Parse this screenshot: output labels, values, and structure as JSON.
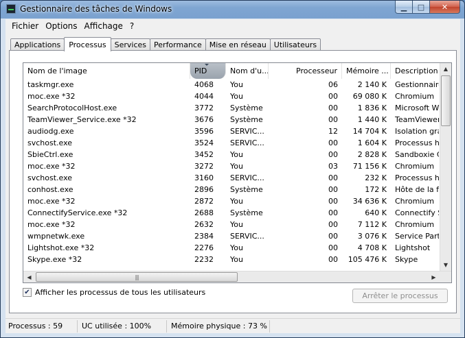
{
  "window": {
    "title": "Gestionnaire des tâches de Windows",
    "buttons": {
      "minimize": "▁",
      "maximize": "□",
      "close": "✕"
    }
  },
  "menu": [
    "Fichier",
    "Options",
    "Affichage",
    "?"
  ],
  "tabs": [
    "Applications",
    "Processus",
    "Services",
    "Performance",
    "Mise en réseau",
    "Utilisateurs"
  ],
  "active_tab": "Processus",
  "table": {
    "columns": [
      "Nom de l'image",
      "PID",
      "Nom d'u...",
      "Processeur",
      "Mémoire ...",
      "Description"
    ],
    "sorted_column": "PID",
    "rows": [
      [
        "taskmgr.exe",
        "4068",
        "You",
        "06",
        "2 140 K",
        "Gestionnaire"
      ],
      [
        "moc.exe *32",
        "4044",
        "You",
        "00",
        "69 080 K",
        "Chromium"
      ],
      [
        "SearchProtocolHost.exe",
        "3772",
        "Système",
        "00",
        "1 836 K",
        "Microsoft Win"
      ],
      [
        "TeamViewer_Service.exe *32",
        "3676",
        "Système",
        "00",
        "1 440 K",
        "TeamViewer"
      ],
      [
        "audiodg.exe",
        "3596",
        "SERVIC...",
        "12",
        "14 704 K",
        "Isolation grap"
      ],
      [
        "svchost.exe",
        "3524",
        "SERVIC...",
        "00",
        "1 604 K",
        "Processus hô"
      ],
      [
        "SbieCtrl.exe",
        "3452",
        "You",
        "00",
        "2 828 K",
        "Sandboxie Co"
      ],
      [
        "moc.exe *32",
        "3272",
        "You",
        "03",
        "71 156 K",
        "Chromium"
      ],
      [
        "svchost.exe",
        "3160",
        "SERVIC...",
        "00",
        "232 K",
        "Processus hô"
      ],
      [
        "conhost.exe",
        "2896",
        "Système",
        "00",
        "172 K",
        "Hôte de la fe"
      ],
      [
        "moc.exe *32",
        "2872",
        "You",
        "00",
        "34 636 K",
        "Chromium"
      ],
      [
        "ConnectifyService.exe *32",
        "2688",
        "Système",
        "00",
        "640 K",
        "Connectify S"
      ],
      [
        "moc.exe *32",
        "2632",
        "You",
        "00",
        "7 112 K",
        "Chromium"
      ],
      [
        "wmpnetwk.exe",
        "2384",
        "SERVIC...",
        "00",
        "3 076 K",
        "Service Parta"
      ],
      [
        "Lightshot.exe *32",
        "2276",
        "You",
        "00",
        "4 708 K",
        "Lightshot"
      ],
      [
        "Skype.exe *32",
        "2232",
        "You",
        "00",
        "105 476 K",
        "Skype"
      ]
    ]
  },
  "show_all_users_label": "Afficher les processus de tous les utilisateurs",
  "show_all_users_checked": true,
  "end_process_label": "Arrêter le processus",
  "status": {
    "processes": "Processus : 59",
    "cpu": "UC utilisée : 100%",
    "memory": "Mémoire physique : 73 %"
  }
}
